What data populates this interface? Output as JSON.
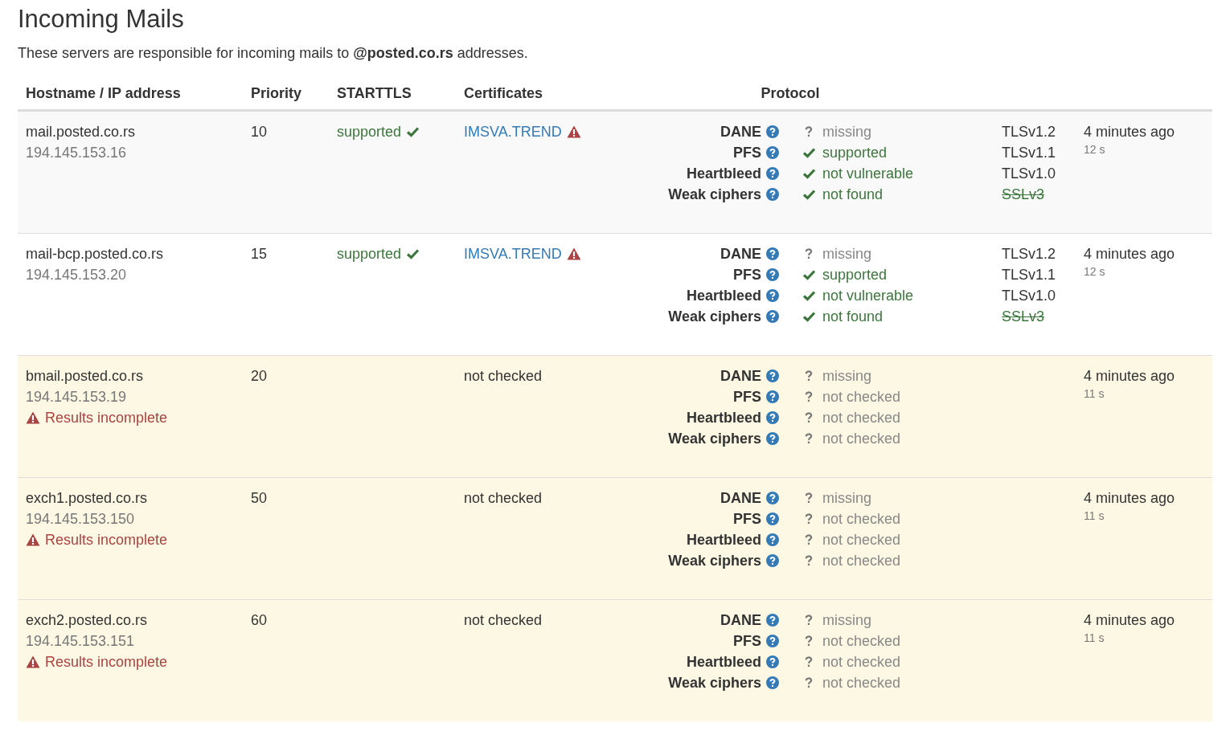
{
  "title": "Incoming Mails",
  "intro": "These servers are responsible for incoming mails to **@posted.co.rs** addresses.",
  "table": {
    "columns": [
      "Hostname / IP address",
      "Priority",
      "STARTTLS",
      "Certificates",
      "Protocol"
    ],
    "rows": [
      {
        "hostname": "mail.posted.co.rs",
        "ip": "194.145.153.16",
        "incomplete": false,
        "priority": "10",
        "starttls": {
          "text": "supported",
          "supported": true
        },
        "certificate": {
          "text": "IMSVA.TREND",
          "kind": "link",
          "warning": true
        },
        "checks": [
          {
            "label": "DANE",
            "kind": "unknown",
            "value": "missing"
          },
          {
            "label": "PFS",
            "kind": "ok",
            "value": "supported"
          },
          {
            "label": "Heartbleed",
            "kind": "ok",
            "value": "not vulnerable"
          },
          {
            "label": "Weak ciphers",
            "kind": "ok",
            "value": "not found"
          }
        ],
        "tls": [
          {
            "label": "TLSv1.2",
            "disabled": false
          },
          {
            "label": "TLSv1.1",
            "disabled": false
          },
          {
            "label": "TLSv1.0",
            "disabled": false
          },
          {
            "label": "SSLv3",
            "disabled": true
          }
        ],
        "checked": "4 minutes ago",
        "duration": "12 s"
      },
      {
        "hostname": "mail-bcp.posted.co.rs",
        "ip": "194.145.153.20",
        "incomplete": false,
        "priority": "15",
        "starttls": {
          "text": "supported",
          "supported": true
        },
        "certificate": {
          "text": "IMSVA.TREND",
          "kind": "link",
          "warning": true
        },
        "checks": [
          {
            "label": "DANE",
            "kind": "unknown",
            "value": "missing"
          },
          {
            "label": "PFS",
            "kind": "ok",
            "value": "supported"
          },
          {
            "label": "Heartbleed",
            "kind": "ok",
            "value": "not vulnerable"
          },
          {
            "label": "Weak ciphers",
            "kind": "ok",
            "value": "not found"
          }
        ],
        "tls": [
          {
            "label": "TLSv1.2",
            "disabled": false
          },
          {
            "label": "TLSv1.1",
            "disabled": false
          },
          {
            "label": "TLSv1.0",
            "disabled": false
          },
          {
            "label": "SSLv3",
            "disabled": true
          }
        ],
        "checked": "4 minutes ago",
        "duration": "12 s"
      },
      {
        "hostname": "bmail.posted.co.rs",
        "ip": "194.145.153.19",
        "incomplete": true,
        "incomplete_text": "Results incomplete",
        "priority": "20",
        "certificate": {
          "text": "not checked",
          "kind": "text",
          "warning": false
        },
        "checks": [
          {
            "label": "DANE",
            "kind": "unknown",
            "value": "missing"
          },
          {
            "label": "PFS",
            "kind": "unknown",
            "value": "not checked"
          },
          {
            "label": "Heartbleed",
            "kind": "unknown",
            "value": "not checked"
          },
          {
            "label": "Weak ciphers",
            "kind": "unknown",
            "value": "not checked"
          }
        ],
        "checked": "4 minutes ago",
        "duration": "11 s"
      },
      {
        "hostname": "exch1.posted.co.rs",
        "ip": "194.145.153.150",
        "incomplete": true,
        "incomplete_text": "Results incomplete",
        "priority": "50",
        "certificate": {
          "text": "not checked",
          "kind": "text",
          "warning": false
        },
        "checks": [
          {
            "label": "DANE",
            "kind": "unknown",
            "value": "missing"
          },
          {
            "label": "PFS",
            "kind": "unknown",
            "value": "not checked"
          },
          {
            "label": "Heartbleed",
            "kind": "unknown",
            "value": "not checked"
          },
          {
            "label": "Weak ciphers",
            "kind": "unknown",
            "value": "not checked"
          }
        ],
        "checked": "4 minutes ago",
        "duration": "11 s"
      },
      {
        "hostname": "exch2.posted.co.rs",
        "ip": "194.145.153.151",
        "incomplete": true,
        "incomplete_text": "Results incomplete",
        "priority": "60",
        "certificate": {
          "text": "not checked",
          "kind": "text",
          "warning": false
        },
        "checks": [
          {
            "label": "DANE",
            "kind": "unknown",
            "value": "missing"
          },
          {
            "label": "PFS",
            "kind": "unknown",
            "value": "not checked"
          },
          {
            "label": "Heartbleed",
            "kind": "unknown",
            "value": "not checked"
          },
          {
            "label": "Weak ciphers",
            "kind": "unknown",
            "value": "not checked"
          }
        ],
        "checked": "4 minutes ago",
        "duration": "11 s"
      }
    ]
  }
}
